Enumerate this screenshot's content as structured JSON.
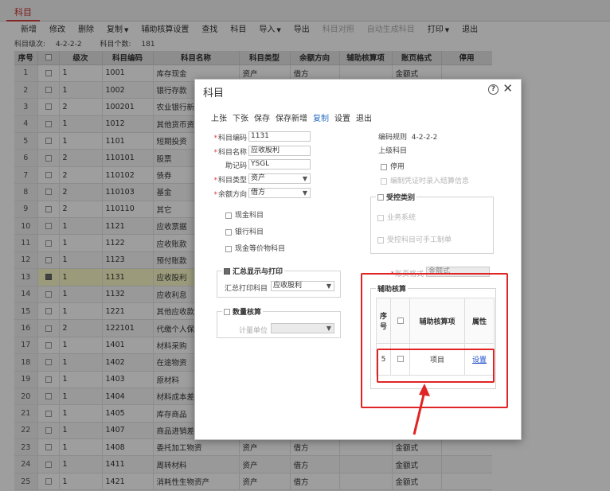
{
  "tab": {
    "label": "科目"
  },
  "toolbar": [
    {
      "label": "新增",
      "caret": false,
      "disabled": false,
      "name": "add-button"
    },
    {
      "label": "修改",
      "caret": false,
      "disabled": false,
      "name": "edit-button"
    },
    {
      "label": "删除",
      "caret": false,
      "disabled": false,
      "name": "delete-button"
    },
    {
      "label": "复制",
      "caret": true,
      "disabled": false,
      "name": "copy-button"
    },
    {
      "label": "辅助核算设置",
      "caret": false,
      "disabled": false,
      "name": "aux-settings-button"
    },
    {
      "label": "查找",
      "caret": false,
      "disabled": false,
      "name": "find-button"
    },
    {
      "label": "科目",
      "caret": false,
      "disabled": false,
      "name": "subject-button"
    },
    {
      "label": "导入",
      "caret": true,
      "disabled": false,
      "name": "import-button"
    },
    {
      "label": "导出",
      "caret": false,
      "disabled": false,
      "name": "export-button"
    },
    {
      "label": "科目对照",
      "caret": false,
      "disabled": true,
      "name": "subject-map-button"
    },
    {
      "label": "自动生成科目",
      "caret": false,
      "disabled": true,
      "name": "auto-gen-button"
    },
    {
      "label": "打印",
      "caret": true,
      "disabled": false,
      "name": "print-button"
    },
    {
      "label": "退出",
      "caret": false,
      "disabled": false,
      "name": "exit-button"
    }
  ],
  "levels": {
    "label": "科目级次:",
    "value": "4-2-2-2",
    "count_label": "科目个数:",
    "count": "181"
  },
  "grid": {
    "headers": [
      "序号",
      "",
      "级次",
      "科目编码",
      "科目名称",
      "科目类型",
      "余额方向",
      "辅助核算项",
      "账页格式",
      "停用"
    ],
    "rows": [
      {
        "no": "1",
        "checked": false,
        "level": "1",
        "code": "1001",
        "name": "库存现金",
        "type": "资产",
        "direction": "借方",
        "aux": "",
        "format": "金额式",
        "stop": ""
      },
      {
        "no": "2",
        "checked": false,
        "level": "1",
        "code": "1002",
        "name": "银行存款",
        "type": "",
        "direction": "",
        "aux": "",
        "format": "",
        "stop": ""
      },
      {
        "no": "3",
        "checked": false,
        "level": "2",
        "code": "100201",
        "name": "农业银行新",
        "type": "",
        "direction": "",
        "aux": "",
        "format": "",
        "stop": ""
      },
      {
        "no": "4",
        "checked": false,
        "level": "1",
        "code": "1012",
        "name": "其他货币资金",
        "type": "",
        "direction": "",
        "aux": "",
        "format": "",
        "stop": ""
      },
      {
        "no": "5",
        "checked": false,
        "level": "1",
        "code": "1101",
        "name": "短期投资",
        "type": "",
        "direction": "",
        "aux": "",
        "format": "",
        "stop": ""
      },
      {
        "no": "6",
        "checked": false,
        "level": "2",
        "code": "110101",
        "name": "股票",
        "type": "",
        "direction": "",
        "aux": "",
        "format": "",
        "stop": ""
      },
      {
        "no": "7",
        "checked": false,
        "level": "2",
        "code": "110102",
        "name": "债券",
        "type": "",
        "direction": "",
        "aux": "",
        "format": "",
        "stop": ""
      },
      {
        "no": "8",
        "checked": false,
        "level": "2",
        "code": "110103",
        "name": "基金",
        "type": "",
        "direction": "",
        "aux": "",
        "format": "",
        "stop": ""
      },
      {
        "no": "9",
        "checked": false,
        "level": "2",
        "code": "110110",
        "name": "其它",
        "type": "",
        "direction": "",
        "aux": "",
        "format": "",
        "stop": ""
      },
      {
        "no": "10",
        "checked": false,
        "level": "1",
        "code": "1121",
        "name": "应收票据",
        "type": "",
        "direction": "",
        "aux": "",
        "format": "",
        "stop": ""
      },
      {
        "no": "11",
        "checked": false,
        "level": "1",
        "code": "1122",
        "name": "应收账款",
        "type": "",
        "direction": "",
        "aux": "",
        "format": "",
        "stop": ""
      },
      {
        "no": "12",
        "checked": false,
        "level": "1",
        "code": "1123",
        "name": "预付账款",
        "type": "",
        "direction": "",
        "aux": "",
        "format": "",
        "stop": ""
      },
      {
        "no": "13",
        "checked": true,
        "level": "1",
        "code": "1131",
        "name": "应收股利",
        "type": "",
        "direction": "",
        "aux": "",
        "format": "",
        "stop": ""
      },
      {
        "no": "14",
        "checked": false,
        "level": "1",
        "code": "1132",
        "name": "应收利息",
        "type": "",
        "direction": "",
        "aux": "",
        "format": "",
        "stop": ""
      },
      {
        "no": "15",
        "checked": false,
        "level": "1",
        "code": "1221",
        "name": "其他应收款",
        "type": "",
        "direction": "",
        "aux": "",
        "format": "",
        "stop": ""
      },
      {
        "no": "16",
        "checked": false,
        "level": "2",
        "code": "122101",
        "name": "代缴个人保",
        "type": "",
        "direction": "",
        "aux": "",
        "format": "",
        "stop": ""
      },
      {
        "no": "17",
        "checked": false,
        "level": "1",
        "code": "1401",
        "name": "材料采购",
        "type": "",
        "direction": "",
        "aux": "",
        "format": "",
        "stop": ""
      },
      {
        "no": "18",
        "checked": false,
        "level": "1",
        "code": "1402",
        "name": "在途物资",
        "type": "",
        "direction": "",
        "aux": "",
        "format": "",
        "stop": ""
      },
      {
        "no": "19",
        "checked": false,
        "level": "1",
        "code": "1403",
        "name": "原材料",
        "type": "",
        "direction": "",
        "aux": "",
        "format": "",
        "stop": ""
      },
      {
        "no": "20",
        "checked": false,
        "level": "1",
        "code": "1404",
        "name": "材料成本差异",
        "type": "",
        "direction": "",
        "aux": "",
        "format": "",
        "stop": ""
      },
      {
        "no": "21",
        "checked": false,
        "level": "1",
        "code": "1405",
        "name": "库存商品",
        "type": "",
        "direction": "",
        "aux": "",
        "format": "",
        "stop": ""
      },
      {
        "no": "22",
        "checked": false,
        "level": "1",
        "code": "1407",
        "name": "商品进销差价",
        "type": "",
        "direction": "",
        "aux": "",
        "format": "",
        "stop": ""
      },
      {
        "no": "23",
        "checked": false,
        "level": "1",
        "code": "1408",
        "name": "委托加工物资",
        "type": "资产",
        "direction": "借方",
        "aux": "",
        "format": "金额式",
        "stop": ""
      },
      {
        "no": "24",
        "checked": false,
        "level": "1",
        "code": "1411",
        "name": "周转材料",
        "type": "资产",
        "direction": "借方",
        "aux": "",
        "format": "金额式",
        "stop": ""
      },
      {
        "no": "25",
        "checked": false,
        "level": "1",
        "code": "1421",
        "name": "消耗性生物资产",
        "type": "资产",
        "direction": "借方",
        "aux": "",
        "format": "金额式",
        "stop": ""
      }
    ]
  },
  "dialog": {
    "title": "科目",
    "toolbar": [
      {
        "label": "上张",
        "active": false
      },
      {
        "label": "下张",
        "active": false
      },
      {
        "label": "保存",
        "active": false
      },
      {
        "label": "保存新增",
        "active": false
      },
      {
        "label": "复制",
        "active": true
      },
      {
        "label": "设置",
        "active": false
      },
      {
        "label": "退出",
        "active": false
      }
    ],
    "fields": {
      "code_label": "科目编码",
      "code_value": "1131",
      "name_label": "科目名称",
      "name_value": "应收股利",
      "mnemonic_label": "助记码",
      "mnemonic_value": "YSGL",
      "type_label": "科目类型",
      "type_value": "资产",
      "direction_label": "余额方向",
      "direction_value": "借方"
    },
    "checks": {
      "cash": "现金科目",
      "bank": "银行科目",
      "cash_equiv": "现金等价物科目"
    },
    "summary": {
      "legend": "汇总显示与打印",
      "label": "汇总打印科目",
      "value": "应收股利"
    },
    "quantity": {
      "legend": "数量核算",
      "label": "计量单位",
      "value": ""
    },
    "right": {
      "rule_label": "编码规则",
      "rule_value": "4-2-2-2",
      "parent_label": "上级科目",
      "stop": "停用",
      "voucher_check": "编制凭证时录入结算信息",
      "control_legend": "受控类别",
      "business": "业务系统",
      "manual": "受控科目可手工制单",
      "format_label": "账页格式",
      "format_value": "金额式"
    },
    "aux": {
      "legend": "辅助核算",
      "headers": {
        "no": "序号",
        "item": "辅助核算项",
        "attr": "属性"
      },
      "rows": [
        {
          "no": "5",
          "item": "项目",
          "attr": "设置"
        }
      ]
    }
  }
}
